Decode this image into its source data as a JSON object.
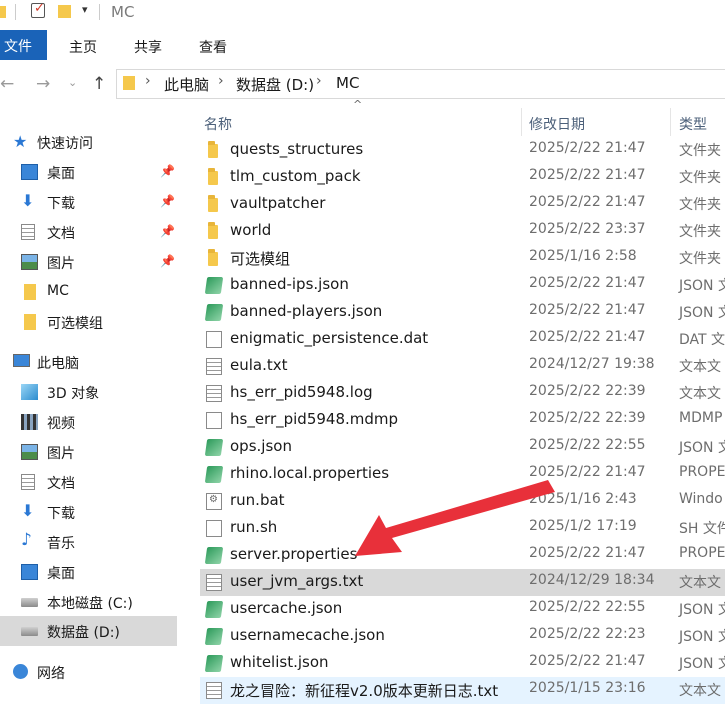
{
  "window": {
    "title": "MC"
  },
  "ribbon": {
    "tabs": [
      "文件",
      "主页",
      "共享",
      "查看"
    ]
  },
  "address": {
    "crumbs": [
      "此电脑",
      "数据盘 (D:)",
      "MC"
    ]
  },
  "nav": {
    "items": [
      {
        "label": "快速访问",
        "icon": "star-icon"
      },
      {
        "label": "桌面",
        "icon": "desktop-icon",
        "pinned": true
      },
      {
        "label": "下载",
        "icon": "download-icon",
        "pinned": true
      },
      {
        "label": "文档",
        "icon": "document-icon",
        "pinned": true
      },
      {
        "label": "图片",
        "icon": "picture-icon",
        "pinned": true
      },
      {
        "label": "MC",
        "icon": "folder-icon"
      },
      {
        "label": "可选模组",
        "icon": "folder-icon"
      },
      {
        "label": "此电脑",
        "icon": "computer-icon"
      },
      {
        "label": "3D 对象",
        "icon": "cube-icon"
      },
      {
        "label": "视频",
        "icon": "video-icon"
      },
      {
        "label": "图片",
        "icon": "picture-icon"
      },
      {
        "label": "文档",
        "icon": "document-icon"
      },
      {
        "label": "下载",
        "icon": "download-icon"
      },
      {
        "label": "音乐",
        "icon": "music-icon"
      },
      {
        "label": "桌面",
        "icon": "desktop-icon"
      },
      {
        "label": "本地磁盘 (C:)",
        "icon": "drive-icon"
      },
      {
        "label": "数据盘 (D:)",
        "icon": "drive-icon"
      },
      {
        "label": "网络",
        "icon": "network-icon"
      }
    ]
  },
  "columns": {
    "name": "名称",
    "date": "修改日期",
    "type": "类型"
  },
  "files": [
    {
      "name": "quests_structures",
      "date": "2025/2/22 21:47",
      "type": "文件夹",
      "kind": "folder"
    },
    {
      "name": "tlm_custom_pack",
      "date": "2025/2/22 21:47",
      "type": "文件夹",
      "kind": "folder"
    },
    {
      "name": "vaultpatcher",
      "date": "2025/2/22 21:47",
      "type": "文件夹",
      "kind": "folder"
    },
    {
      "name": "world",
      "date": "2025/2/22 23:37",
      "type": "文件夹",
      "kind": "folder"
    },
    {
      "name": "可选模组",
      "date": "2025/1/16 2:58",
      "type": "文件夹",
      "kind": "folder"
    },
    {
      "name": "banned-ips.json",
      "date": "2025/2/22 21:47",
      "type": "JSON 文",
      "kind": "json"
    },
    {
      "name": "banned-players.json",
      "date": "2025/2/22 21:47",
      "type": "JSON 文",
      "kind": "json"
    },
    {
      "name": "enigmatic_persistence.dat",
      "date": "2025/2/22 21:47",
      "type": "DAT 文",
      "kind": "doc"
    },
    {
      "name": "eula.txt",
      "date": "2024/12/27 19:38",
      "type": "文本文",
      "kind": "txt"
    },
    {
      "name": "hs_err_pid5948.log",
      "date": "2025/2/22 22:39",
      "type": "文本文",
      "kind": "txt"
    },
    {
      "name": "hs_err_pid5948.mdmp",
      "date": "2025/2/22 22:39",
      "type": "MDMP",
      "kind": "doc"
    },
    {
      "name": "ops.json",
      "date": "2025/2/22 22:55",
      "type": "JSON 文",
      "kind": "json"
    },
    {
      "name": "rhino.local.properties",
      "date": "2025/2/22 21:47",
      "type": "PROPE",
      "kind": "json"
    },
    {
      "name": "run.bat",
      "date": "2025/1/16 2:43",
      "type": "Windo",
      "kind": "bat"
    },
    {
      "name": "run.sh",
      "date": "2025/1/2 17:19",
      "type": "SH 文件",
      "kind": "doc"
    },
    {
      "name": "server.properties",
      "date": "2025/2/22 21:47",
      "type": "PROPE",
      "kind": "json"
    },
    {
      "name": "user_jvm_args.txt",
      "date": "2024/12/29 18:34",
      "type": "文本文",
      "kind": "txt",
      "state": "selected"
    },
    {
      "name": "usercache.json",
      "date": "2025/2/22 22:55",
      "type": "JSON 文",
      "kind": "json"
    },
    {
      "name": "usernamecache.json",
      "date": "2025/2/22 22:23",
      "type": "JSON 文",
      "kind": "json"
    },
    {
      "name": "whitelist.json",
      "date": "2025/2/22 21:47",
      "type": "JSON 文",
      "kind": "json"
    },
    {
      "name": "龙之冒险：新征程v2.0版本更新日志.txt",
      "date": "2025/1/15 23:16",
      "type": "文本文",
      "kind": "txt",
      "state": "hover"
    }
  ],
  "colors": {
    "accent": "#1a63b8",
    "arrow": "#e8303a",
    "selected": "#d9d9d9",
    "hover": "#e5f3ff"
  }
}
